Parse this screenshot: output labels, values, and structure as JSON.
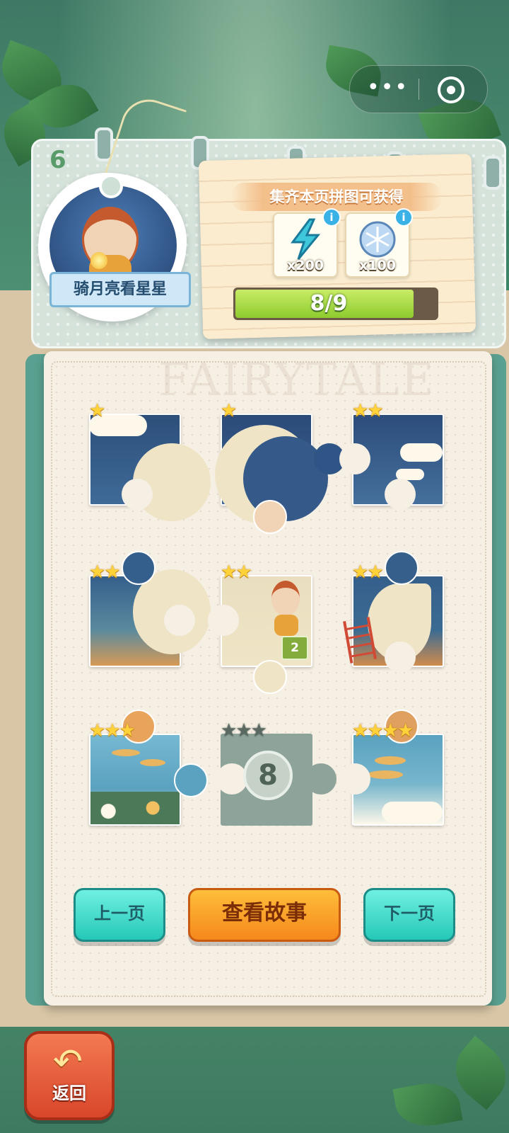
{
  "chapter": {
    "page_number": "6",
    "story_title": "骑月亮看星星"
  },
  "reward": {
    "title": "集齐本页拼图可获得",
    "items": [
      {
        "icon": "lightning-icon",
        "count": "x200"
      },
      {
        "icon": "snowflake-coin-icon",
        "count": "x100"
      }
    ],
    "info_symbol": "i",
    "progress_text": "8/9",
    "progress_fraction": 0.889
  },
  "page_watermark": "FAIRYTALE",
  "pieces": [
    {
      "stars": 1,
      "max_stars": 1,
      "unlocked": true
    },
    {
      "stars": 1,
      "max_stars": 1,
      "unlocked": true
    },
    {
      "stars": 2,
      "max_stars": 2,
      "unlocked": true
    },
    {
      "stars": 2,
      "max_stars": 2,
      "unlocked": true
    },
    {
      "stars": 2,
      "max_stars": 2,
      "unlocked": true,
      "badge": "2"
    },
    {
      "stars": 2,
      "max_stars": 2,
      "unlocked": true
    },
    {
      "stars": 3,
      "max_stars": 3,
      "unlocked": true
    },
    {
      "stars": 0,
      "max_stars": 3,
      "unlocked": false,
      "lock_number": "8"
    },
    {
      "stars": 4,
      "max_stars": 4,
      "unlocked": true
    }
  ],
  "buttons": {
    "prev": "上一页",
    "story": "查看故事",
    "next": "下一页",
    "back": "返回"
  },
  "colors": {
    "teal_button": "#25c8b8",
    "orange_button": "#f5881c",
    "progress_green": "#8ecb2e"
  }
}
